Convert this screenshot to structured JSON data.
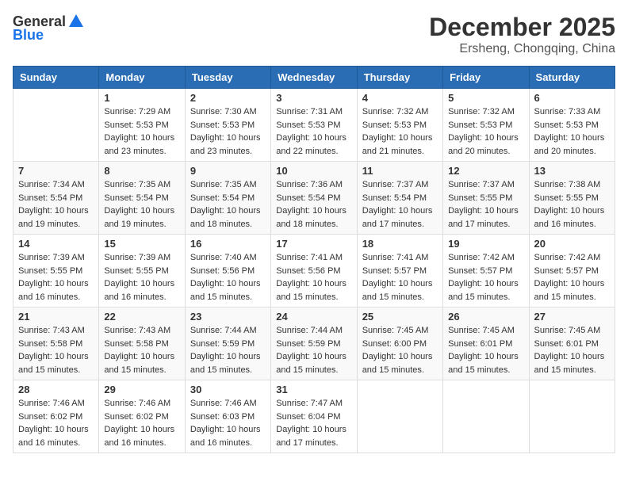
{
  "header": {
    "logo_general": "General",
    "logo_blue": "Blue",
    "month_year": "December 2025",
    "location": "Ersheng, Chongqing, China"
  },
  "columns": [
    "Sunday",
    "Monday",
    "Tuesday",
    "Wednesday",
    "Thursday",
    "Friday",
    "Saturday"
  ],
  "weeks": [
    {
      "days": [
        {
          "number": "",
          "info": ""
        },
        {
          "number": "1",
          "info": "Sunrise: 7:29 AM\nSunset: 5:53 PM\nDaylight: 10 hours\nand 23 minutes."
        },
        {
          "number": "2",
          "info": "Sunrise: 7:30 AM\nSunset: 5:53 PM\nDaylight: 10 hours\nand 23 minutes."
        },
        {
          "number": "3",
          "info": "Sunrise: 7:31 AM\nSunset: 5:53 PM\nDaylight: 10 hours\nand 22 minutes."
        },
        {
          "number": "4",
          "info": "Sunrise: 7:32 AM\nSunset: 5:53 PM\nDaylight: 10 hours\nand 21 minutes."
        },
        {
          "number": "5",
          "info": "Sunrise: 7:32 AM\nSunset: 5:53 PM\nDaylight: 10 hours\nand 20 minutes."
        },
        {
          "number": "6",
          "info": "Sunrise: 7:33 AM\nSunset: 5:53 PM\nDaylight: 10 hours\nand 20 minutes."
        }
      ]
    },
    {
      "days": [
        {
          "number": "7",
          "info": "Sunrise: 7:34 AM\nSunset: 5:54 PM\nDaylight: 10 hours\nand 19 minutes."
        },
        {
          "number": "8",
          "info": "Sunrise: 7:35 AM\nSunset: 5:54 PM\nDaylight: 10 hours\nand 19 minutes."
        },
        {
          "number": "9",
          "info": "Sunrise: 7:35 AM\nSunset: 5:54 PM\nDaylight: 10 hours\nand 18 minutes."
        },
        {
          "number": "10",
          "info": "Sunrise: 7:36 AM\nSunset: 5:54 PM\nDaylight: 10 hours\nand 18 minutes."
        },
        {
          "number": "11",
          "info": "Sunrise: 7:37 AM\nSunset: 5:54 PM\nDaylight: 10 hours\nand 17 minutes."
        },
        {
          "number": "12",
          "info": "Sunrise: 7:37 AM\nSunset: 5:55 PM\nDaylight: 10 hours\nand 17 minutes."
        },
        {
          "number": "13",
          "info": "Sunrise: 7:38 AM\nSunset: 5:55 PM\nDaylight: 10 hours\nand 16 minutes."
        }
      ]
    },
    {
      "days": [
        {
          "number": "14",
          "info": "Sunrise: 7:39 AM\nSunset: 5:55 PM\nDaylight: 10 hours\nand 16 minutes."
        },
        {
          "number": "15",
          "info": "Sunrise: 7:39 AM\nSunset: 5:55 PM\nDaylight: 10 hours\nand 16 minutes."
        },
        {
          "number": "16",
          "info": "Sunrise: 7:40 AM\nSunset: 5:56 PM\nDaylight: 10 hours\nand 15 minutes."
        },
        {
          "number": "17",
          "info": "Sunrise: 7:41 AM\nSunset: 5:56 PM\nDaylight: 10 hours\nand 15 minutes."
        },
        {
          "number": "18",
          "info": "Sunrise: 7:41 AM\nSunset: 5:57 PM\nDaylight: 10 hours\nand 15 minutes."
        },
        {
          "number": "19",
          "info": "Sunrise: 7:42 AM\nSunset: 5:57 PM\nDaylight: 10 hours\nand 15 minutes."
        },
        {
          "number": "20",
          "info": "Sunrise: 7:42 AM\nSunset: 5:57 PM\nDaylight: 10 hours\nand 15 minutes."
        }
      ]
    },
    {
      "days": [
        {
          "number": "21",
          "info": "Sunrise: 7:43 AM\nSunset: 5:58 PM\nDaylight: 10 hours\nand 15 minutes."
        },
        {
          "number": "22",
          "info": "Sunrise: 7:43 AM\nSunset: 5:58 PM\nDaylight: 10 hours\nand 15 minutes."
        },
        {
          "number": "23",
          "info": "Sunrise: 7:44 AM\nSunset: 5:59 PM\nDaylight: 10 hours\nand 15 minutes."
        },
        {
          "number": "24",
          "info": "Sunrise: 7:44 AM\nSunset: 5:59 PM\nDaylight: 10 hours\nand 15 minutes."
        },
        {
          "number": "25",
          "info": "Sunrise: 7:45 AM\nSunset: 6:00 PM\nDaylight: 10 hours\nand 15 minutes."
        },
        {
          "number": "26",
          "info": "Sunrise: 7:45 AM\nSunset: 6:01 PM\nDaylight: 10 hours\nand 15 minutes."
        },
        {
          "number": "27",
          "info": "Sunrise: 7:45 AM\nSunset: 6:01 PM\nDaylight: 10 hours\nand 15 minutes."
        }
      ]
    },
    {
      "days": [
        {
          "number": "28",
          "info": "Sunrise: 7:46 AM\nSunset: 6:02 PM\nDaylight: 10 hours\nand 16 minutes."
        },
        {
          "number": "29",
          "info": "Sunrise: 7:46 AM\nSunset: 6:02 PM\nDaylight: 10 hours\nand 16 minutes."
        },
        {
          "number": "30",
          "info": "Sunrise: 7:46 AM\nSunset: 6:03 PM\nDaylight: 10 hours\nand 16 minutes."
        },
        {
          "number": "31",
          "info": "Sunrise: 7:47 AM\nSunset: 6:04 PM\nDaylight: 10 hours\nand 17 minutes."
        },
        {
          "number": "",
          "info": ""
        },
        {
          "number": "",
          "info": ""
        },
        {
          "number": "",
          "info": ""
        }
      ]
    }
  ]
}
